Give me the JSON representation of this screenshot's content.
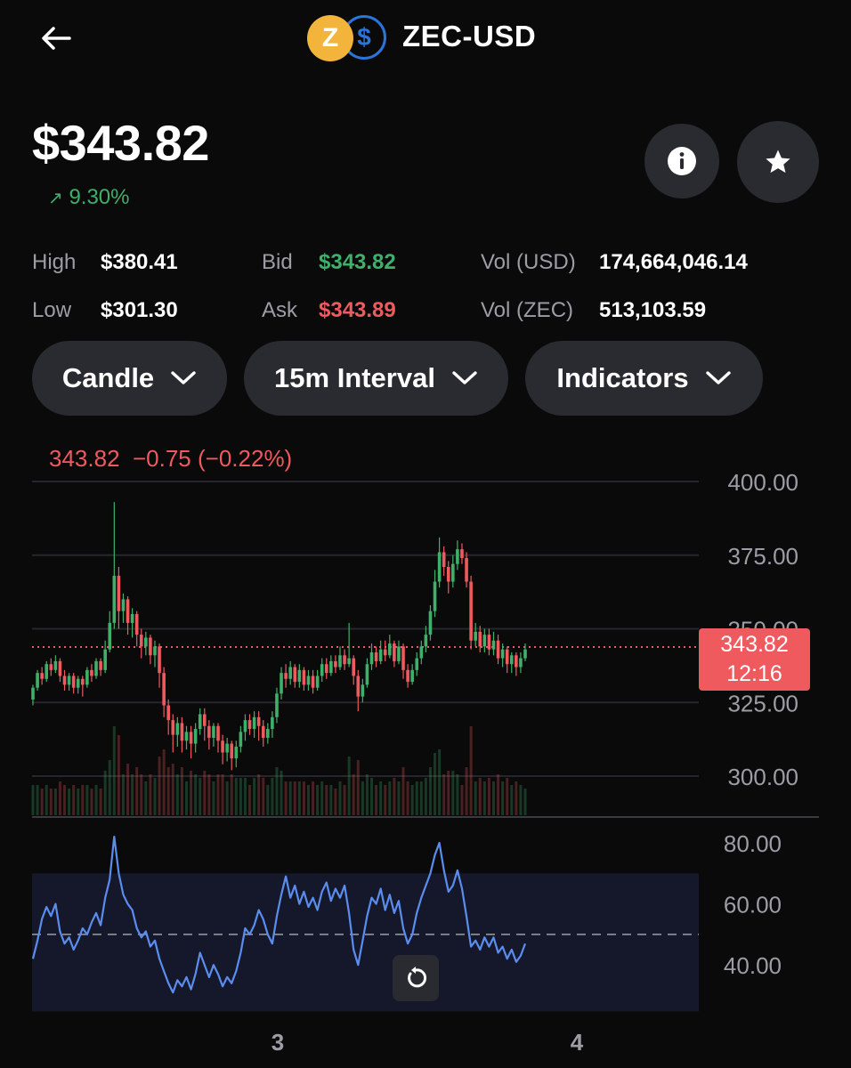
{
  "header": {
    "pair": "ZEC-USD",
    "coin_glyph": "Z",
    "quote_glyph": "$"
  },
  "summary": {
    "price": "$343.82",
    "change": "9.30%",
    "change_arrow": "↗"
  },
  "stats": {
    "high_label": "High",
    "high": "$380.41",
    "low_label": "Low",
    "low": "$301.30",
    "bid_label": "Bid",
    "bid": "$343.82",
    "ask_label": "Ask",
    "ask": "$343.89",
    "vol_usd_label": "Vol (USD)",
    "vol_usd": "174,664,046.14",
    "vol_zec_label": "Vol (ZEC)",
    "vol_zec": "513,103.59"
  },
  "controls": {
    "chart_type": "Candle",
    "interval": "15m Interval",
    "indicators": "Indicators"
  },
  "readout": {
    "price": "343.82",
    "change": "−0.75 (−0.22%)"
  },
  "price_tag": {
    "price": "343.82",
    "countdown": "12:16"
  },
  "colors": {
    "up": "#3fb06a",
    "down": "#ef5a5f",
    "rsi": "#5b8def",
    "background": "#0a0a0b"
  },
  "icons": [
    "back-arrow-icon",
    "zcash-coin-icon",
    "usd-coin-icon",
    "info-icon",
    "star-icon",
    "chevron-down-icon",
    "reset-icon"
  ],
  "chart_data": {
    "type": "candlestick",
    "price_axis": {
      "ticks": [
        "400.00",
        "375.00",
        "350.00",
        "325.00",
        "300.00"
      ],
      "range": [
        289,
        401
      ]
    },
    "rsi_axis": {
      "ticks": [
        "80.00",
        "60.00",
        "40.00"
      ],
      "range": [
        30,
        82
      ],
      "midline": 50
    },
    "x_ticks": [
      "3",
      "4"
    ],
    "current_price": 343.82,
    "candles": [
      [
        326,
        330,
        331,
        324
      ],
      [
        330,
        335,
        336,
        329
      ],
      [
        335,
        333,
        337,
        331
      ],
      [
        333,
        338,
        339,
        332
      ],
      [
        338,
        336,
        340,
        334
      ],
      [
        336,
        339,
        341,
        335
      ],
      [
        339,
        334,
        340,
        332
      ],
      [
        334,
        331,
        336,
        329
      ],
      [
        331,
        334,
        335,
        329
      ],
      [
        334,
        330,
        335,
        328
      ],
      [
        330,
        333,
        334,
        328
      ],
      [
        333,
        331,
        334,
        327
      ],
      [
        331,
        336,
        337,
        330
      ],
      [
        336,
        334,
        338,
        332
      ],
      [
        334,
        339,
        340,
        333
      ],
      [
        339,
        336,
        340,
        334
      ],
      [
        336,
        343,
        346,
        335
      ],
      [
        343,
        352,
        356,
        342
      ],
      [
        352,
        368,
        393,
        350
      ],
      [
        368,
        356,
        371,
        350
      ],
      [
        356,
        360,
        362,
        352
      ],
      [
        360,
        352,
        361,
        348
      ],
      [
        352,
        355,
        357,
        347
      ],
      [
        355,
        348,
        356,
        344
      ],
      [
        348,
        344,
        350,
        340
      ],
      [
        344,
        347,
        349,
        341
      ],
      [
        347,
        341,
        348,
        338
      ],
      [
        341,
        344,
        346,
        337
      ],
      [
        344,
        335,
        345,
        330
      ],
      [
        335,
        324,
        337,
        320
      ],
      [
        324,
        319,
        326,
        314
      ],
      [
        319,
        314,
        321,
        308
      ],
      [
        314,
        318,
        320,
        310
      ],
      [
        318,
        312,
        320,
        308
      ],
      [
        312,
        315,
        317,
        309
      ],
      [
        315,
        311,
        317,
        306
      ],
      [
        311,
        316,
        318,
        308
      ],
      [
        316,
        321,
        323,
        314
      ],
      [
        321,
        317,
        323,
        312
      ],
      [
        317,
        313,
        319,
        309
      ],
      [
        313,
        317,
        318,
        310
      ],
      [
        317,
        312,
        318,
        308
      ],
      [
        312,
        308,
        314,
        304
      ],
      [
        308,
        311,
        313,
        305
      ],
      [
        311,
        306,
        312,
        302
      ],
      [
        306,
        310,
        312,
        303
      ],
      [
        310,
        315,
        317,
        308
      ],
      [
        315,
        319,
        321,
        312
      ],
      [
        319,
        316,
        321,
        314
      ],
      [
        316,
        320,
        322,
        313
      ],
      [
        320,
        317,
        322,
        312
      ],
      [
        317,
        313,
        319,
        310
      ],
      [
        313,
        316,
        318,
        311
      ],
      [
        316,
        320,
        322,
        313
      ],
      [
        320,
        328,
        330,
        318
      ],
      [
        328,
        335,
        337,
        326
      ],
      [
        335,
        333,
        338,
        330
      ],
      [
        333,
        337,
        339,
        331
      ],
      [
        337,
        332,
        338,
        330
      ],
      [
        332,
        336,
        338,
        330
      ],
      [
        336,
        331,
        337,
        329
      ],
      [
        331,
        334,
        336,
        329
      ],
      [
        334,
        330,
        336,
        328
      ],
      [
        330,
        334,
        336,
        329
      ],
      [
        334,
        338,
        340,
        332
      ],
      [
        338,
        335,
        340,
        333
      ],
      [
        335,
        339,
        341,
        334
      ],
      [
        339,
        337,
        341,
        335
      ],
      [
        337,
        341,
        344,
        336
      ],
      [
        341,
        338,
        343,
        336
      ],
      [
        338,
        340,
        352,
        337
      ],
      [
        340,
        334,
        341,
        331
      ],
      [
        334,
        327,
        336,
        322
      ],
      [
        327,
        331,
        333,
        325
      ],
      [
        331,
        338,
        340,
        330
      ],
      [
        338,
        342,
        345,
        336
      ],
      [
        342,
        339,
        344,
        337
      ],
      [
        339,
        343,
        346,
        338
      ],
      [
        343,
        341,
        346,
        339
      ],
      [
        341,
        345,
        348,
        340
      ],
      [
        345,
        339,
        346,
        337
      ],
      [
        339,
        344,
        346,
        338
      ],
      [
        344,
        336,
        345,
        333
      ],
      [
        336,
        332,
        338,
        330
      ],
      [
        332,
        336,
        338,
        331
      ],
      [
        336,
        340,
        342,
        334
      ],
      [
        340,
        344,
        346,
        338
      ],
      [
        344,
        348,
        351,
        342
      ],
      [
        348,
        356,
        358,
        346
      ],
      [
        356,
        366,
        370,
        354
      ],
      [
        366,
        376,
        381,
        364
      ],
      [
        376,
        371,
        378,
        368
      ],
      [
        371,
        366,
        373,
        362
      ],
      [
        366,
        372,
        375,
        364
      ],
      [
        372,
        377,
        380,
        370
      ],
      [
        377,
        374,
        379,
        372
      ],
      [
        374,
        366,
        376,
        364
      ],
      [
        366,
        346,
        368,
        343
      ],
      [
        346,
        349,
        352,
        344
      ],
      [
        349,
        344,
        351,
        342
      ],
      [
        344,
        348,
        350,
        342
      ],
      [
        348,
        343,
        350,
        341
      ],
      [
        343,
        346,
        349,
        341
      ],
      [
        346,
        340,
        348,
        338
      ],
      [
        340,
        343,
        345,
        337
      ],
      [
        343,
        338,
        344,
        335
      ],
      [
        338,
        341,
        342,
        335
      ],
      [
        341,
        337,
        342,
        334
      ],
      [
        337,
        340,
        342,
        335
      ],
      [
        340,
        343,
        345,
        339
      ]
    ],
    "rsi": [
      42,
      48,
      55,
      59,
      56,
      60,
      51,
      47,
      49,
      45,
      48,
      52,
      50,
      54,
      57,
      53,
      62,
      68,
      82,
      70,
      63,
      60,
      58,
      52,
      49,
      51,
      46,
      48,
      42,
      38,
      34,
      31,
      35,
      33,
      36,
      32,
      37,
      44,
      40,
      36,
      40,
      37,
      33,
      36,
      34,
      38,
      44,
      52,
      50,
      53,
      58,
      55,
      50,
      47,
      56,
      63,
      69,
      62,
      66,
      60,
      64,
      59,
      62,
      58,
      64,
      67,
      61,
      65,
      62,
      66,
      57,
      45,
      40,
      48,
      56,
      62,
      60,
      65,
      58,
      63,
      57,
      61,
      52,
      47,
      50,
      57,
      62,
      66,
      70,
      76,
      80,
      71,
      64,
      66,
      71,
      65,
      56,
      46,
      48,
      45,
      49,
      46,
      49,
      44,
      46,
      42,
      45,
      41,
      43,
      47
    ]
  }
}
